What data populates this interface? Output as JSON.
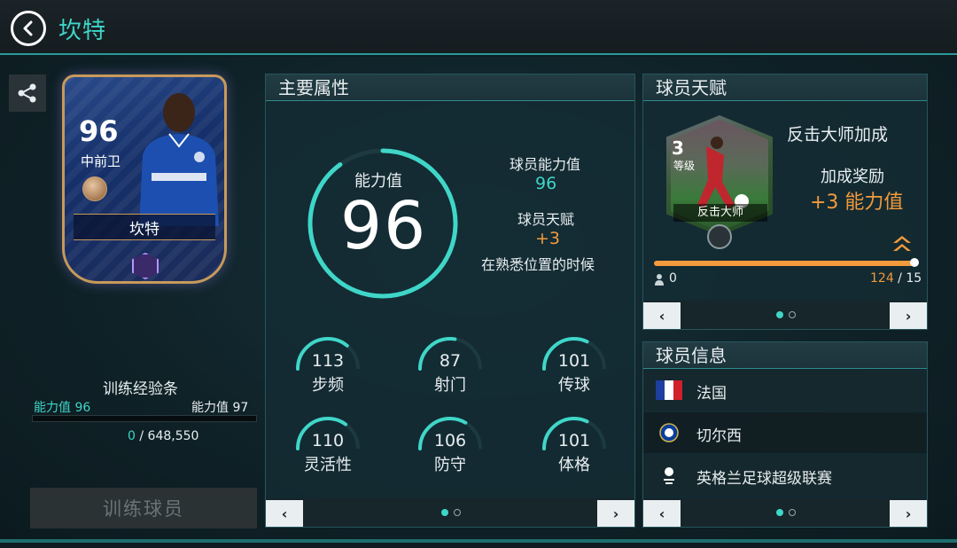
{
  "header": {
    "title": "坎特",
    "back_icon": "back-arrow-icon"
  },
  "card": {
    "rating": "96",
    "position": "中前卫",
    "name": "坎特"
  },
  "training": {
    "title": "训练经验条",
    "left_label": "能力值",
    "left_value": "96",
    "right_label": "能力值",
    "right_value": "97",
    "current": "0",
    "separator": "/",
    "total": "648,550",
    "progress": 0,
    "button_label": "训练球员"
  },
  "attributes": {
    "header": "主要属性",
    "ring_label": "能力值",
    "ring_value": "96",
    "ring_fill": 0.9,
    "player_rating_label": "球员能力值",
    "player_rating_value": "96",
    "talent_label": "球员天赋",
    "talent_value": "+3",
    "talent_condition": "在熟悉位置的时候",
    "stats": [
      {
        "name": "步频",
        "value": "113",
        "fill": 0.72
      },
      {
        "name": "射门",
        "value": "87",
        "fill": 0.55
      },
      {
        "name": "传球",
        "value": "101",
        "fill": 0.64
      },
      {
        "name": "灵活性",
        "value": "110",
        "fill": 0.7
      },
      {
        "name": "防守",
        "value": "106",
        "fill": 0.67
      },
      {
        "name": "体格",
        "value": "101",
        "fill": 0.64
      }
    ],
    "prev_label": "‹",
    "next_label": "›"
  },
  "talent": {
    "header": "球员天赋",
    "level": "3",
    "level_label": "等级",
    "caption": "反击大师",
    "name": "反击大师加成",
    "bonus_label": "加成奖励",
    "bonus_value": "+3 能力值",
    "zero": "0",
    "progress_current": "124",
    "progress_sep": " / ",
    "progress_total": "15",
    "prev_label": "‹",
    "next_label": "›"
  },
  "info": {
    "header": "球员信息",
    "rows": [
      {
        "text": "法国",
        "icon": "france-flag-icon"
      },
      {
        "text": "切尔西",
        "icon": "chelsea-crest-icon"
      },
      {
        "text": "英格兰足球超级联赛",
        "icon": "premier-league-icon"
      }
    ],
    "prev_label": "‹",
    "next_label": "›"
  },
  "colors": {
    "accent": "#3fd6c8",
    "orange": "#f29a3c",
    "background": "#0f1c22"
  }
}
